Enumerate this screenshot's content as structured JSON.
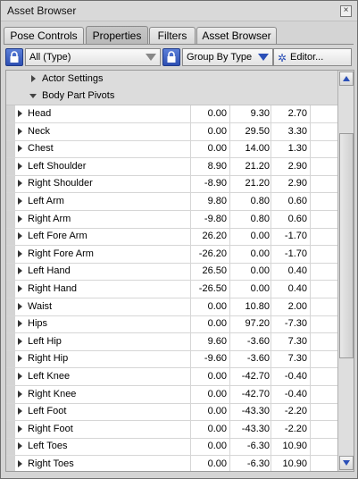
{
  "window": {
    "title": "Asset Browser",
    "close_glyph": "×"
  },
  "tabs": [
    {
      "label": "Pose Controls",
      "active": false
    },
    {
      "label": "Properties",
      "active": true
    },
    {
      "label": "Filters",
      "active": false
    },
    {
      "label": "Asset Browser",
      "active": false
    }
  ],
  "toolbar": {
    "filter_value": "All (Type)",
    "group_value": "Group By Type",
    "editor_label": "Editor...",
    "editor_icon": "gear-icon",
    "lock_icon": "lock-icon"
  },
  "groups": {
    "actor_settings": "Actor Settings",
    "body_part_pivots": "Body Part Pivots"
  },
  "rows": [
    {
      "name": "Head",
      "v1": "0.00",
      "v2": "9.30",
      "v3": "2.70"
    },
    {
      "name": "Neck",
      "v1": "0.00",
      "v2": "29.50",
      "v3": "3.30"
    },
    {
      "name": "Chest",
      "v1": "0.00",
      "v2": "14.00",
      "v3": "1.30"
    },
    {
      "name": "Left Shoulder",
      "v1": "8.90",
      "v2": "21.20",
      "v3": "2.90"
    },
    {
      "name": "Right Shoulder",
      "v1": "-8.90",
      "v2": "21.20",
      "v3": "2.90"
    },
    {
      "name": "Left Arm",
      "v1": "9.80",
      "v2": "0.80",
      "v3": "0.60"
    },
    {
      "name": "Right Arm",
      "v1": "-9.80",
      "v2": "0.80",
      "v3": "0.60"
    },
    {
      "name": "Left Fore Arm",
      "v1": "26.20",
      "v2": "0.00",
      "v3": "-1.70"
    },
    {
      "name": "Right Fore Arm",
      "v1": "-26.20",
      "v2": "0.00",
      "v3": "-1.70"
    },
    {
      "name": "Left Hand",
      "v1": "26.50",
      "v2": "0.00",
      "v3": "0.40"
    },
    {
      "name": "Right Hand",
      "v1": "-26.50",
      "v2": "0.00",
      "v3": "0.40"
    },
    {
      "name": "Waist",
      "v1": "0.00",
      "v2": "10.80",
      "v3": "2.00"
    },
    {
      "name": "Hips",
      "v1": "0.00",
      "v2": "97.20",
      "v3": "-7.30"
    },
    {
      "name": "Left Hip",
      "v1": "9.60",
      "v2": "-3.60",
      "v3": "7.30"
    },
    {
      "name": "Right Hip",
      "v1": "-9.60",
      "v2": "-3.60",
      "v3": "7.30"
    },
    {
      "name": "Left Knee",
      "v1": "0.00",
      "v2": "-42.70",
      "v3": "-0.40"
    },
    {
      "name": "Right Knee",
      "v1": "0.00",
      "v2": "-42.70",
      "v3": "-0.40"
    },
    {
      "name": "Left Foot",
      "v1": "0.00",
      "v2": "-43.30",
      "v3": "-2.20"
    },
    {
      "name": "Right Foot",
      "v1": "0.00",
      "v2": "-43.30",
      "v3": "-2.20"
    },
    {
      "name": "Left Toes",
      "v1": "0.00",
      "v2": "-6.30",
      "v3": "10.90"
    },
    {
      "name": "Right Toes",
      "v1": "0.00",
      "v2": "-6.30",
      "v3": "10.90"
    }
  ],
  "colors": {
    "accent": "#2b4fb7",
    "window_bg": "#d4d4d4",
    "row_line": "#d6d6d6"
  }
}
